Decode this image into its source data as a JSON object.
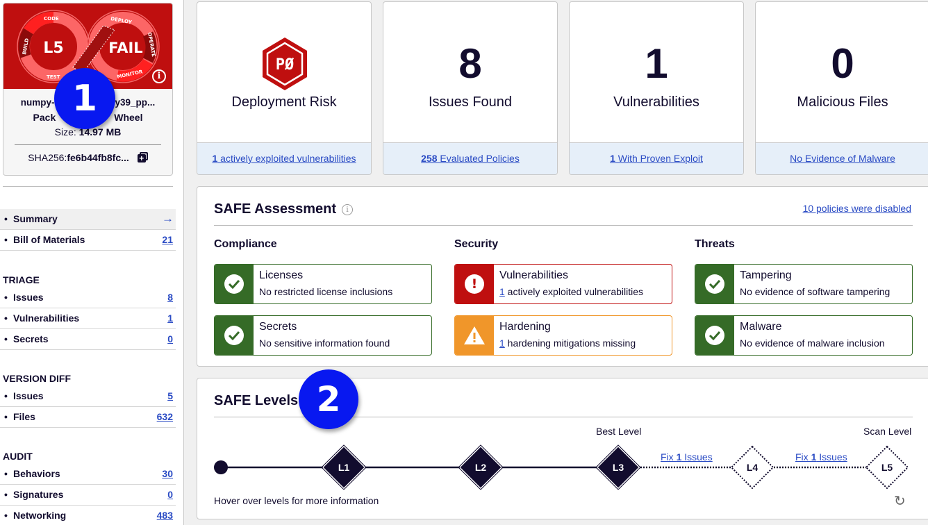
{
  "package": {
    "level_badge": "L5",
    "status_badge": "FAIL",
    "lifecycle_labels": [
      "CODE",
      "BUILD",
      "TEST",
      "DEPLOY",
      "OPERATE",
      "MONITOR"
    ],
    "name": "numpy-1.26.4-pp39-pypy39_pp...",
    "name_visible": "numpy-1.     py39_pp...",
    "type_label": "Package Type:",
    "type_value": "Wheel",
    "type_visible": "Pack      Wheel",
    "size_label": "Size:",
    "size_value": "14.97 MB",
    "sha_label": "SHA256:",
    "sha_value": "fe6b44fb8fc..."
  },
  "sidebar": {
    "top_items": [
      {
        "label": "Summary",
        "active": true,
        "icon": "arrow-right-icon"
      },
      {
        "label": "Bill of Materials",
        "count": "21"
      }
    ],
    "groups": [
      {
        "title": "TRIAGE",
        "items": [
          {
            "label": "Issues",
            "count": "8"
          },
          {
            "label": "Vulnerabilities",
            "count": "1"
          },
          {
            "label": "Secrets",
            "count": "0"
          }
        ]
      },
      {
        "title": "VERSION DIFF",
        "items": [
          {
            "label": "Issues",
            "count": "5"
          },
          {
            "label": "Files",
            "count": "632"
          }
        ]
      },
      {
        "title": "AUDIT",
        "items": [
          {
            "label": "Behaviors",
            "count": "30"
          },
          {
            "label": "Signatures",
            "count": "0"
          },
          {
            "label": "Networking",
            "count": "483"
          }
        ]
      }
    ]
  },
  "stats": [
    {
      "icon_text": "PØ",
      "label": "Deployment Risk",
      "foot_num": "1",
      "foot_text": " actively exploited vulnerabilities"
    },
    {
      "value": "8",
      "label": "Issues Found",
      "foot_num": "258",
      "foot_text": " Evaluated Policies"
    },
    {
      "value": "1",
      "label": "Vulnerabilities",
      "foot_num": "1",
      "foot_text": " With Proven Exploit"
    },
    {
      "value": "0",
      "label": "Malicious Files",
      "foot_num": "",
      "foot_text": "No Evidence of Malware"
    }
  ],
  "assessment": {
    "title": "SAFE Assessment",
    "disabled_link": "10 policies were disabled",
    "columns": [
      {
        "title": "Compliance",
        "items": [
          {
            "status": "pass",
            "icon": "check-icon",
            "title": "Licenses",
            "num": "",
            "desc": "No restricted license inclusions"
          },
          {
            "status": "pass",
            "icon": "check-icon",
            "title": "Secrets",
            "num": "",
            "desc": "No sensitive information found"
          }
        ]
      },
      {
        "title": "Security",
        "items": [
          {
            "status": "fail",
            "icon": "exclamation-icon",
            "title": "Vulnerabilities",
            "num": "1",
            "desc": " actively exploited vulnerabilities"
          },
          {
            "status": "warning",
            "icon": "warning-icon",
            "title": "Hardening",
            "num": "1",
            "desc": " hardening mitigations missing"
          }
        ]
      },
      {
        "title": "Threats",
        "items": [
          {
            "status": "pass",
            "icon": "check-icon",
            "title": "Tampering",
            "num": "",
            "desc": "No evidence of software tampering"
          },
          {
            "status": "pass",
            "icon": "check-icon",
            "title": "Malware",
            "num": "",
            "desc": "No evidence of malware inclusion"
          }
        ]
      }
    ]
  },
  "levels": {
    "title": "SAFE Levels",
    "nodes": [
      "L1",
      "L2",
      "L3",
      "L4",
      "L5"
    ],
    "best_level_label": "Best Level",
    "scan_level_label": "Scan Level",
    "fix_links": [
      {
        "prefix": "Fix ",
        "num": "1",
        "suffix": " Issues"
      },
      {
        "prefix": "Fix ",
        "num": "1",
        "suffix": " Issues"
      }
    ],
    "hover_note": "Hover over levels for more information"
  },
  "annotations": [
    "1",
    "2"
  ],
  "colors": {
    "fail_red": "#bf0f0f",
    "pass_green": "#356b27",
    "warning_orange": "#f0962a",
    "link_blue": "#2a4bc4",
    "navy": "#120c2e",
    "annotation_blue": "#0818f0"
  }
}
